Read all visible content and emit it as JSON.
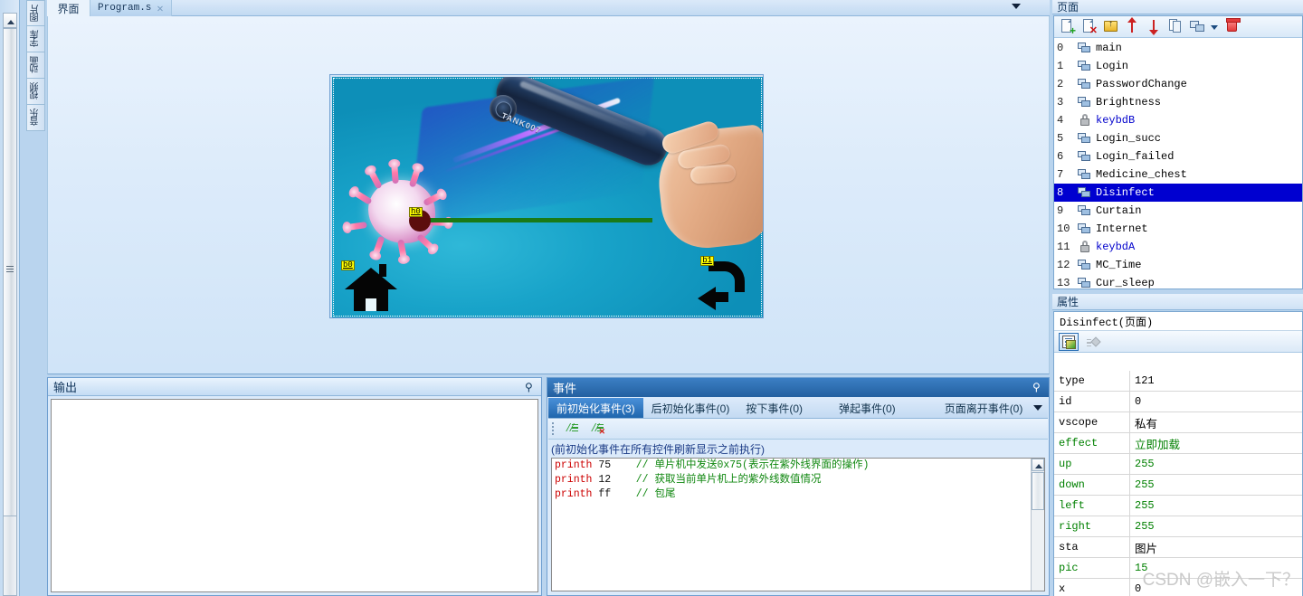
{
  "window": {
    "tool_tabs": [
      {
        "label": "图片",
        "name": "picture"
      },
      {
        "label": "字库",
        "name": "font-library"
      },
      {
        "label": "动画",
        "name": "animation"
      },
      {
        "label": "视频",
        "name": "video"
      },
      {
        "label": "音乐",
        "name": "music"
      }
    ],
    "doc_tabs": [
      {
        "label": "界面",
        "active": true
      },
      {
        "label": "Program.s",
        "active": false,
        "close": "✕"
      }
    ]
  },
  "canvas": {
    "widgets": [
      {
        "tag": "h0",
        "type": "slider"
      },
      {
        "tag": "b0",
        "type": "home-button"
      },
      {
        "tag": "b1",
        "type": "back-button"
      }
    ],
    "device_label": "TANK007"
  },
  "output": {
    "title": "输出",
    "pin": "⚲",
    "content": ""
  },
  "events": {
    "title": "事件",
    "pin": "⚲",
    "tabs": [
      {
        "label": "前初始化事件(3)",
        "active": true
      },
      {
        "label": "后初始化事件(0)",
        "active": false
      },
      {
        "label": "按下事件(0)",
        "active": false
      },
      {
        "label": "弹起事件(0)",
        "active": false
      },
      {
        "label": "页面离开事件(0)",
        "active": false
      }
    ],
    "note": "(前初始化事件在所有控件刷新显示之前执行)",
    "code": [
      {
        "kw": "printh",
        "arg": "75",
        "comment": "// 单片机中发送0x75(表示在紫外线界面的操作)"
      },
      {
        "kw": "printh",
        "arg": "12",
        "comment": "// 获取当前单片机上的紫外线数值情况"
      },
      {
        "kw": "printh",
        "arg": "ff",
        "comment": "// 包尾"
      }
    ],
    "toolbar": [
      {
        "name": "add-comment",
        "label": "//"
      },
      {
        "name": "remove-comment",
        "label": "//"
      }
    ]
  },
  "pages": {
    "title": "页面",
    "toolbar": [
      {
        "name": "new-page-button"
      },
      {
        "name": "delete-page-button"
      },
      {
        "name": "move-to-folder-button"
      },
      {
        "name": "move-up-button"
      },
      {
        "name": "move-down-button"
      },
      {
        "name": "copy-page-button"
      },
      {
        "name": "page-options-button"
      },
      {
        "name": "page-options-dropdown"
      },
      {
        "name": "trash-button"
      }
    ],
    "items": [
      {
        "index": "0",
        "label": "main",
        "icon": "page",
        "selected": false
      },
      {
        "index": "1",
        "label": "Login",
        "icon": "page",
        "selected": false
      },
      {
        "index": "2",
        "label": "PasswordChange",
        "icon": "page",
        "selected": false
      },
      {
        "index": "3",
        "label": "Brightness",
        "icon": "page",
        "selected": false
      },
      {
        "index": "4",
        "label": "keybdB",
        "icon": "lock",
        "selected": false
      },
      {
        "index": "5",
        "label": "Login_succ",
        "icon": "page",
        "selected": false
      },
      {
        "index": "6",
        "label": "Login_failed",
        "icon": "page",
        "selected": false
      },
      {
        "index": "7",
        "label": "Medicine_chest",
        "icon": "page",
        "selected": false
      },
      {
        "index": "8",
        "label": "Disinfect",
        "icon": "page",
        "selected": true
      },
      {
        "index": "9",
        "label": "Curtain",
        "icon": "page",
        "selected": false
      },
      {
        "index": "10",
        "label": "Internet",
        "icon": "page",
        "selected": false
      },
      {
        "index": "11",
        "label": "keybdA",
        "icon": "lock",
        "selected": false
      },
      {
        "index": "12",
        "label": "MC_Time",
        "icon": "page",
        "selected": false
      },
      {
        "index": "13",
        "label": "Cur_sleep",
        "icon": "page",
        "selected": false
      }
    ]
  },
  "properties": {
    "title": "属性",
    "object": "Disinfect(页面)",
    "rows": [
      {
        "key": "type",
        "value": "121",
        "key_green": false,
        "val_green": false,
        "cn": false
      },
      {
        "key": "id",
        "value": "0",
        "key_green": false,
        "val_green": false,
        "cn": false
      },
      {
        "key": "vscope",
        "value": "私有",
        "key_green": false,
        "val_green": false,
        "cn": true
      },
      {
        "key": "effect",
        "value": "立即加载",
        "key_green": true,
        "val_green": true,
        "cn": true
      },
      {
        "key": "up",
        "value": "255",
        "key_green": true,
        "val_green": true,
        "cn": false
      },
      {
        "key": "down",
        "value": "255",
        "key_green": true,
        "val_green": true,
        "cn": false
      },
      {
        "key": "left",
        "value": "255",
        "key_green": true,
        "val_green": true,
        "cn": false
      },
      {
        "key": "right",
        "value": "255",
        "key_green": true,
        "val_green": true,
        "cn": false
      },
      {
        "key": "sta",
        "value": "图片",
        "key_green": false,
        "val_green": false,
        "cn": true
      },
      {
        "key": "pic",
        "value": "15",
        "key_green": true,
        "val_green": true,
        "cn": false
      },
      {
        "key": "x",
        "value": "0",
        "key_green": false,
        "val_green": false,
        "cn": false
      }
    ]
  },
  "watermark": "CSDN @嵌入一下？",
  "colors": {
    "accent": "#2360a0",
    "selection": "#0000d0",
    "green_value": "#008000",
    "keyword_red": "#cc0000",
    "comment_green": "#118811"
  }
}
